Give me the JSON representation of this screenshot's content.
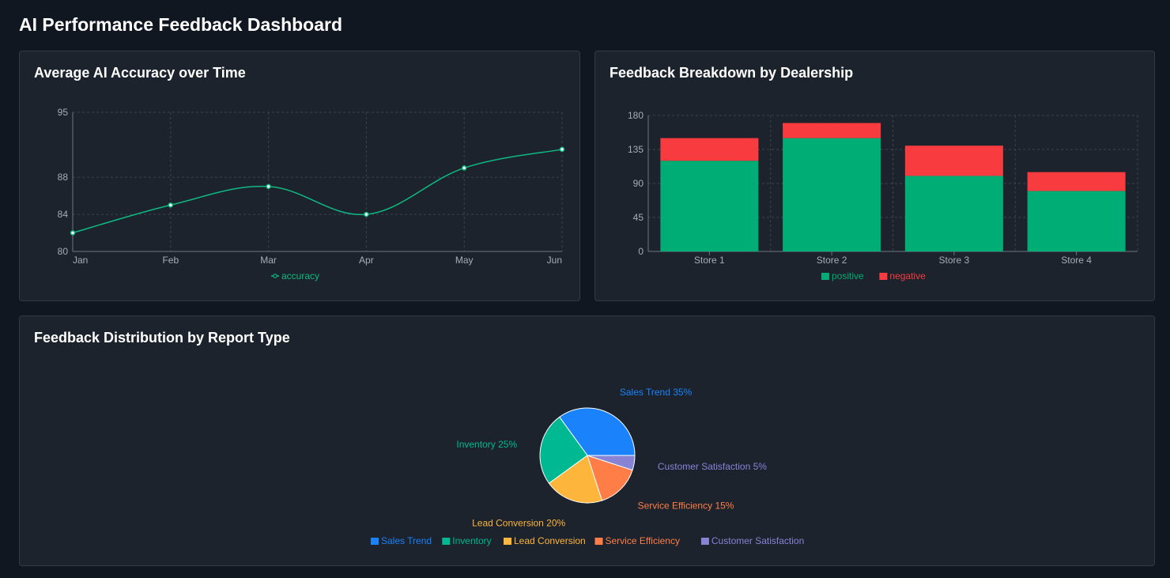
{
  "page": {
    "title": "AI Performance Feedback Dashboard"
  },
  "colors": {
    "accuracy": "#10b981",
    "positive": "#00ad74",
    "negative": "#f73b3f",
    "grid": "#3a4350",
    "tick": "#a5adb8",
    "axis": "#6b7480"
  },
  "charts": {
    "accuracy": {
      "title": "Average AI Accuracy over Time"
    },
    "dealership": {
      "title": "Feedback Breakdown by Dealership"
    },
    "report_type": {
      "title": "Feedback Distribution by Report Type"
    }
  },
  "chart_data": [
    {
      "type": "line",
      "title": "Average AI Accuracy over Time",
      "x": [
        "Jan",
        "Feb",
        "Mar",
        "Apr",
        "May",
        "Jun"
      ],
      "series": [
        {
          "name": "accuracy",
          "values": [
            82,
            85,
            87,
            84,
            89,
            91
          ],
          "color": "#10b981"
        }
      ],
      "yticks": [
        80,
        84,
        88,
        95
      ],
      "ylim": [
        80,
        95
      ],
      "grid": true,
      "legend": "bottom-center"
    },
    {
      "type": "bar",
      "stacked": true,
      "title": "Feedback Breakdown by Dealership",
      "categories": [
        "Store 1",
        "Store 2",
        "Store 3",
        "Store 4"
      ],
      "series": [
        {
          "name": "positive",
          "values": [
            120,
            150,
            100,
            80
          ],
          "color": "#00ad74"
        },
        {
          "name": "negative",
          "values": [
            30,
            20,
            40,
            25
          ],
          "color": "#f73b3f"
        }
      ],
      "yticks": [
        0,
        45,
        90,
        135,
        180
      ],
      "ylim": [
        0,
        180
      ],
      "grid": true,
      "legend": "bottom-center"
    },
    {
      "type": "pie",
      "title": "Feedback Distribution by Report Type",
      "slices": [
        {
          "name": "Sales Trend",
          "value": 35,
          "label": "Sales Trend 35%",
          "color": "#1a82fb"
        },
        {
          "name": "Inventory",
          "value": 25,
          "label": "Inventory 25%",
          "color": "#00b992"
        },
        {
          "name": "Lead Conversion",
          "value": 20,
          "label": "Lead Conversion 20%",
          "color": "#feb53b"
        },
        {
          "name": "Service Efficiency",
          "value": 15,
          "label": "Service Efficiency 15%",
          "color": "#ff7d47"
        },
        {
          "name": "Customer Satisfaction",
          "value": 5,
          "label": "Customer Satisfaction 5%",
          "color": "#8784d6"
        }
      ],
      "legend": "bottom-center"
    }
  ]
}
